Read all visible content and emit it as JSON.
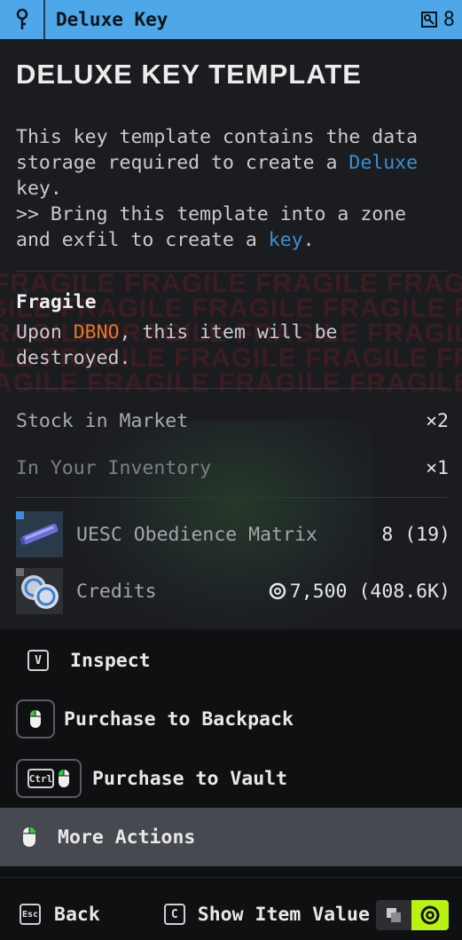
{
  "header": {
    "title": "Deluxe Key",
    "count": "8",
    "icon": "key-icon",
    "right_icon": "key-stack-icon"
  },
  "item": {
    "title": "DELUXE KEY TEMPLATE",
    "desc_1": "This key template contains the data storage required to create a ",
    "desc_hl_1": "Deluxe",
    "desc_2": " key.",
    "desc_3": ">> Bring this template into a zone and exfil to create a ",
    "desc_hl_2": "key",
    "desc_4": "."
  },
  "fragile": {
    "title": "Fragile",
    "text_1": "Upon ",
    "text_hl": "DBNO",
    "text_2": ", this item will be destroyed.",
    "watermark": "FRAGILE FRAGILE FRAGILE FRAGILE FRAGILE"
  },
  "stats": {
    "market_label": "Stock in Market",
    "market_value": "×2",
    "inventory_label": "In Your Inventory",
    "inventory_value": "×1"
  },
  "costs": [
    {
      "name": "UESC Obedience Matrix",
      "amount": "8 (19)",
      "corner_color": "#3a8fe0"
    },
    {
      "name": "Credits",
      "amount": "7,500 (408.6K)",
      "corner_color": "#6a6c70"
    }
  ],
  "actions": {
    "inspect_key": "V",
    "inspect": "Inspect",
    "backpack": "Purchase to Backpack",
    "vault_key": "Ctrl",
    "vault": "Purchase to Vault",
    "more": "More Actions"
  },
  "footer": {
    "back_key": "Esc",
    "back": "Back",
    "show_key": "C",
    "show": "Show Item Value"
  },
  "colors": {
    "accent_blue": "#4ea7e8",
    "highlight_blue": "#3d8fd4",
    "warning_orange": "#e2762c",
    "toggle_green": "#b8f20e"
  }
}
